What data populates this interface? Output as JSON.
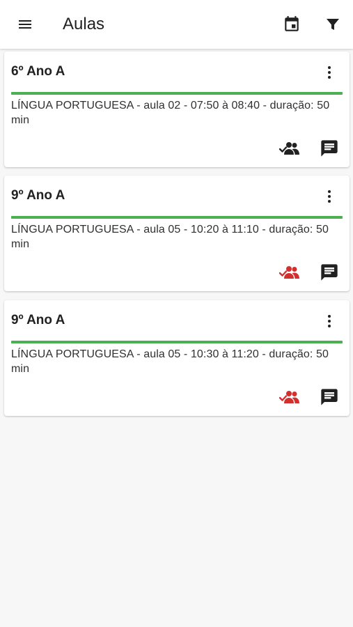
{
  "appbar": {
    "title": "Aulas",
    "icons": {
      "menu": "menu-icon",
      "calendar": "calendar-icon",
      "filter": "filter-icon"
    }
  },
  "colors": {
    "progress": "#4caf50",
    "attendance_done": "#212121",
    "attendance_pending": "#d32f2f",
    "icon": "#212121"
  },
  "lessons": [
    {
      "title": "6º Ano A",
      "description": "LÍNGUA PORTUGUESA - aula 02 - 07:50 à 08:40 - duração: 50 min",
      "attendance_status": "done"
    },
    {
      "title": "9º Ano A",
      "description": "LÍNGUA PORTUGUESA - aula 05 - 10:20 à 11:10 - duração: 50 min",
      "attendance_status": "pending"
    },
    {
      "title": "9º Ano A",
      "description": "LÍNGUA PORTUGUESA - aula 05 - 10:30 à 11:20 - duração: 50 min",
      "attendance_status": "pending"
    }
  ]
}
